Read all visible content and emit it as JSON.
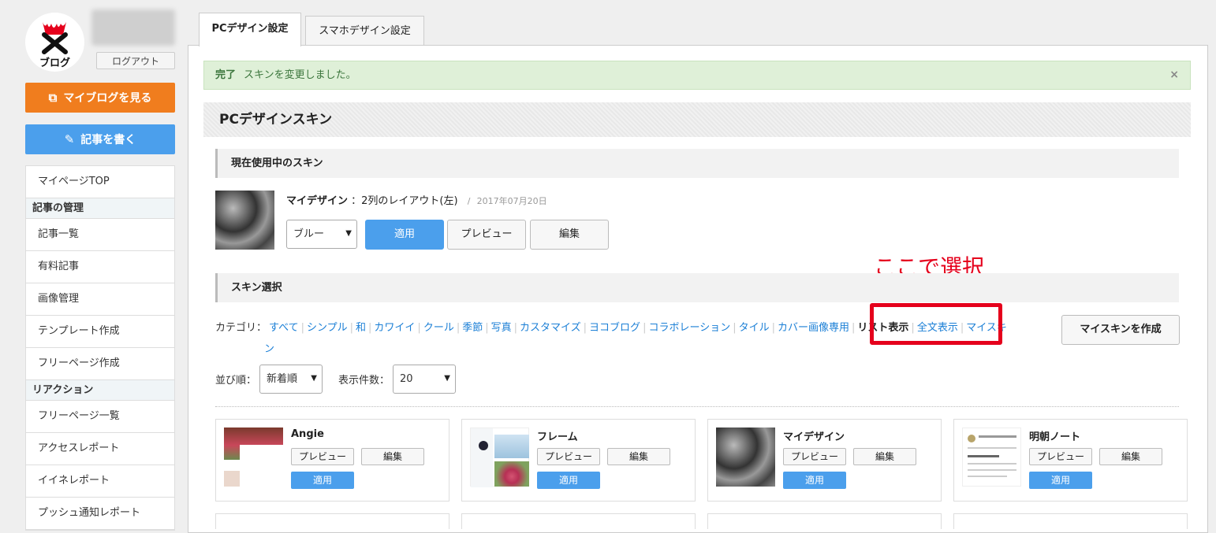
{
  "sidebar": {
    "logo_text": "ブログ",
    "logout": "ログアウト",
    "view_blog": "マイブログを見る",
    "write_article": "記事を書く",
    "menu": {
      "top": "マイページTOP",
      "group1": "記事の管理",
      "article_list": "記事一覧",
      "paid_articles": "有料記事",
      "image_mgmt": "画像管理",
      "template_create": "テンプレート作成",
      "free_page_create": "フリーページ作成",
      "group2": "リアクション",
      "free_page_list": "フリーページ一覧",
      "access_report": "アクセスレポート",
      "like_report": "イイネレポート",
      "push_report": "プッシュ通知レポート"
    }
  },
  "tabs": {
    "pc": "PCデザイン設定",
    "sp": "スマホデザイン設定"
  },
  "alert": {
    "label": "完了",
    "message": "スキンを変更しました。",
    "close": "×"
  },
  "section_title": "PCデザインスキン",
  "current_skin": {
    "heading": "現在使用中のスキン",
    "name": "マイデザイン",
    "layout": "：2列のレイアウト(左)",
    "separator": "/",
    "date": "2017年07月20日",
    "color_select": "ブルー",
    "apply": "適用",
    "preview": "プレビュー",
    "edit": "編集"
  },
  "annotation": "ここで選択",
  "skin_select": {
    "heading": "スキン選択",
    "category_label": "カテゴリ：",
    "categories": [
      "すべて",
      "シンプル",
      "和",
      "カワイイ",
      "クール",
      "季節",
      "写真",
      "カスタマイズ",
      "ヨコブログ",
      "コラボレーション",
      "タイル",
      "カバー画像専用",
      "リスト表示",
      "全文表示",
      "マイスキ"
    ],
    "category_wrap": "ン",
    "selected_category": "リスト表示",
    "create_my_skin": "マイスキンを作成",
    "sort_label": "並び順：",
    "sort_value": "新着順",
    "count_label": "表示件数：",
    "count_value": "20"
  },
  "skins": [
    {
      "name": "Angie",
      "preview": "プレビュー",
      "edit": "編集",
      "apply": "適用"
    },
    {
      "name": "フレーム",
      "preview": "プレビュー",
      "edit": "編集",
      "apply": "適用"
    },
    {
      "name": "マイデザイン",
      "preview": "プレビュー",
      "edit": "編集",
      "apply": "適用"
    },
    {
      "name": "明朝ノート",
      "preview": "プレビュー",
      "edit": "編集",
      "apply": "適用"
    }
  ],
  "colors": {
    "orange": "#f07d1e",
    "blue": "#4b9fec",
    "link": "#1b7fd6",
    "highlight": "#e5001c",
    "success_bg": "#dff0d8"
  }
}
